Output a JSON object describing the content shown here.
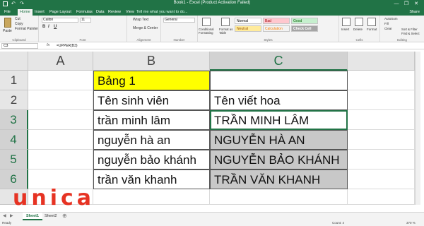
{
  "app": {
    "title": "Book1 - Excel (Product Activation Failed)"
  },
  "window_buttons": [
    "—",
    "❐",
    "✕"
  ],
  "tabs": [
    "File",
    "Home",
    "Insert",
    "Page Layout",
    "Formulas",
    "Data",
    "Review",
    "View"
  ],
  "active_tab": "Home",
  "tell_me": "Tell me what you want to do...",
  "share": "Share",
  "ribbon": {
    "clipboard": {
      "paste": "Paste",
      "cut": "Cut",
      "copy": "Copy",
      "format_painter": "Format Painter",
      "label": "Clipboard"
    },
    "font": {
      "name": "Calibri",
      "size": "11",
      "bold": "B",
      "italic": "I",
      "underline": "U",
      "label": "Font"
    },
    "alignment": {
      "wrap_text": "Wrap Text",
      "merge_center": "Merge & Center",
      "label": "Alignment"
    },
    "number": {
      "format": "General",
      "label": "Number"
    },
    "styles": {
      "conditional": "Conditional Formatting",
      "format_table": "Format as Table",
      "normal": "Normal",
      "bad": "Bad",
      "good": "Good",
      "neutral": "Neutral",
      "calculation": "Calculation",
      "check_cell": "Check Cell",
      "label": "Styles"
    },
    "cells": {
      "insert": "Insert",
      "delete": "Delete",
      "format": "Format",
      "label": "Cells"
    },
    "editing": {
      "autosum": "AutoSum",
      "fill": "Fill",
      "clear": "Clear",
      "sort_filter": "Sort & Filter",
      "find_select": "Find & Select",
      "label": "Editing"
    }
  },
  "formula_bar": {
    "name_box": "C3",
    "fx": "fx",
    "formula": "=UPPER(B3)"
  },
  "columns": [
    "A",
    "B",
    "C"
  ],
  "selected_column": "C",
  "rows": [
    {
      "num": "1",
      "a": "",
      "b": "Bảng 1",
      "c": ""
    },
    {
      "num": "2",
      "a": "",
      "b": "Tên sinh viên",
      "c": "Tên viết hoa"
    },
    {
      "num": "3",
      "a": "",
      "b": "trần minh lâm",
      "c": "TRẦN MINH LÂM"
    },
    {
      "num": "4",
      "a": "",
      "b": "nguyễn hà an",
      "c": "NGUYỄN HÀ AN"
    },
    {
      "num": "5",
      "a": "",
      "b": "nguyễn bảo khánh",
      "c": "NGUYỄN BẢO KHÁNH"
    },
    {
      "num": "6",
      "a": "",
      "b": "trần văn khanh",
      "c": "TRẦN VĂN KHANH"
    }
  ],
  "sheets": [
    "Sheet1",
    "Sheet2"
  ],
  "active_sheet": "Sheet1",
  "status": {
    "ready": "Ready",
    "count": "Count: 4",
    "zoom": "370 %"
  },
  "watermark": "unica",
  "colors": {
    "excel_green": "#217346",
    "header_yellow": "#ffff00",
    "selection_gray": "#c8c8c8",
    "logo_red": "#e63323"
  }
}
